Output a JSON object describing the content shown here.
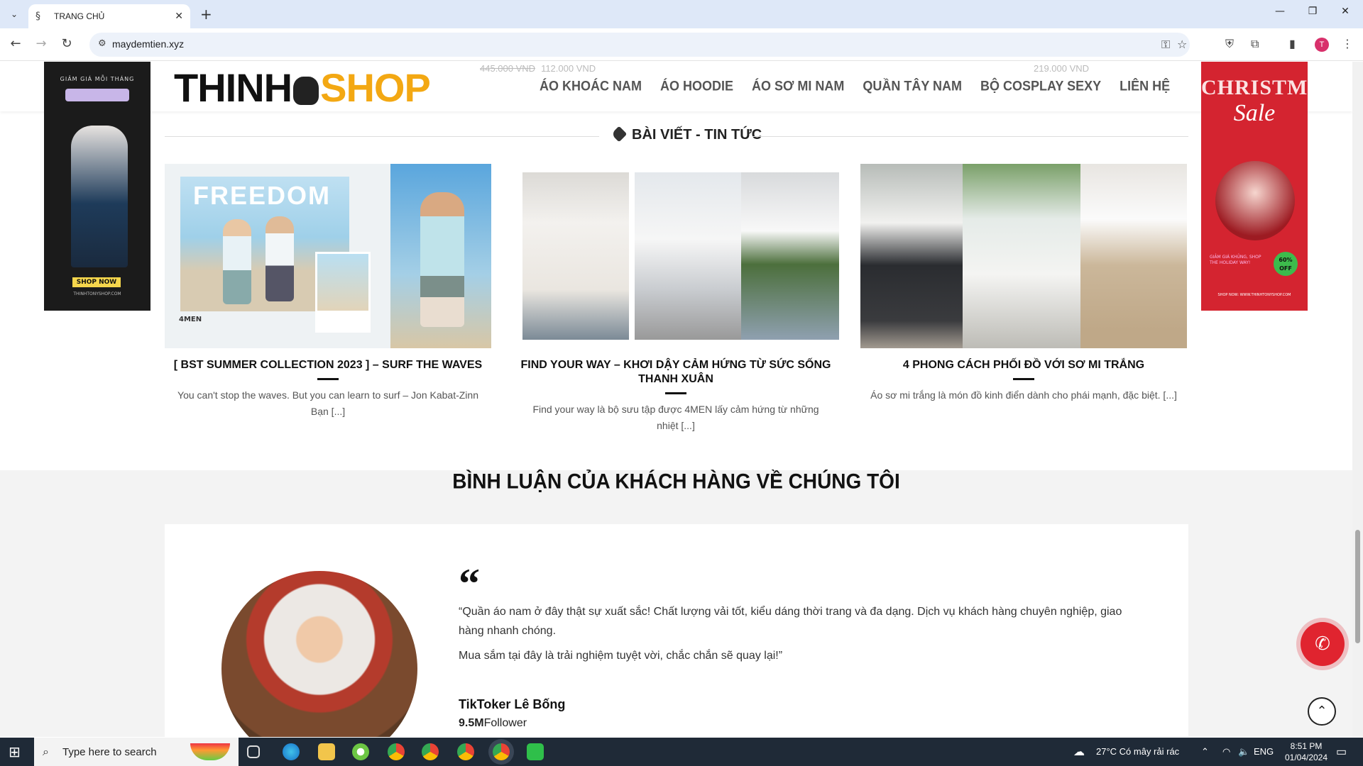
{
  "browser": {
    "tab_title": "TRANG CHỦ",
    "url": "maydemtien.xyz",
    "profile_initial": "T"
  },
  "site": {
    "logo_part1": "THINH",
    "logo_part2": "SHOP",
    "ghost_prices": [
      {
        "old": "445.000 VND",
        "new": "112.000 VND"
      },
      {
        "old": "",
        "new": "219.000 VND"
      }
    ],
    "nav": [
      "ÁO KHOÁC NAM",
      "ÁO HOODIE",
      "ÁO SƠ MI NAM",
      "QUẦN TÂY NAM",
      "BỘ COSPLAY SEXY",
      "LIÊN HỆ"
    ]
  },
  "banners": {
    "left": {
      "header": "GIẢM GIÁ MỖI THÁNG",
      "shop_now": "SHOP NOW",
      "site": "THINHTONYSHOP.COM"
    },
    "right": {
      "title": "CHRISTMAS",
      "sale": "Sale",
      "small": "GIẢM GIÁ KHỦNG, SHOP THE HOLIDAY WAY!",
      "off": "60% OFF",
      "url": "SHOP NOW: WWW.THINHTONYSHOP.COM"
    }
  },
  "posts_section": {
    "title": "BÀI VIẾT - TIN TỨC",
    "posts": [
      {
        "title": "[ BST SUMMER COLLECTION 2023 ] – SURF THE WAVES",
        "excerpt": "You can't stop the waves. But you can learn to surf – Jon Kabat-Zinn Bạn [...]",
        "image_word": "FREEDOM",
        "image_brand": "4MEN"
      },
      {
        "title": "FIND YOUR WAY – KHƠI DẬY CẢM HỨNG TỪ SỨC SỐNG THANH XUÂN",
        "excerpt": "Find your way là bộ sưu tập được 4MEN lấy cảm hứng từ những nhiệt [...]"
      },
      {
        "title": "4 PHONG CÁCH PHỐI ĐỒ VỚI SƠ MI TRẮNG",
        "excerpt": "Áo sơ mi trắng là món đồ kinh điển dành cho phái mạnh, đặc biệt. [...]"
      }
    ]
  },
  "reviews": {
    "title": "BÌNH LUẬN CỦA KHÁCH HÀNG VỀ CHÚNG TÔI",
    "quote_mark": "“",
    "paragraph1": "“Quần áo nam ở đây thật sự xuất sắc! Chất lượng vải tốt, kiểu dáng thời trang và đa dạng. Dịch vụ khách hàng chuyên nghiệp, giao hàng nhanh chóng.",
    "paragraph2": "Mua sắm tại đây là trải nghiệm tuyệt vời, chắc chắn sẽ quay lại!”",
    "reviewer": "TikToker Lê Bống",
    "followers_count": "9.5M",
    "followers_label": "Follower"
  },
  "taskbar": {
    "search_placeholder": "Type here to search",
    "weather": "27°C  Có mây rải rác",
    "language": "ENG",
    "time": "8:51 PM",
    "date": "01/04/2024"
  }
}
